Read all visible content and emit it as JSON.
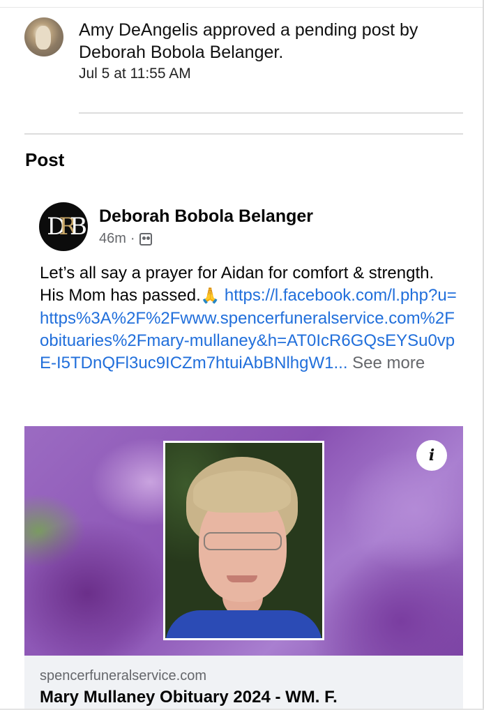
{
  "notification": {
    "message": "Amy DeAngelis approved a pending post by Deborah Bobola Belanger.",
    "timestamp": "Jul 5 at 11:55 AM"
  },
  "section_title": "Post",
  "post": {
    "author": "Deborah Bobola Belanger",
    "avatar_monogram": "DRB",
    "age": "46m",
    "meta_separator": "·",
    "audience_icon": "group-icon",
    "text": "Let’s all say a prayer for Aidan for comfort & strength. His Mom has passed.",
    "emoji": "🙏",
    "link_text": "https://l.facebook.com/l.php?u=https%3A%2F%2Fwww.spencerfuneralservice.com%2Fobituaries%2Fmary-mullaney&h=AT0IcR6GQsEYSu0vpE-I5TDnQFl3uc9ICZm7htuiAbBNlhgW1...",
    "see_more": "See more"
  },
  "link_preview": {
    "domain": "spencerfuneralservice.com",
    "title": "Mary Mullaney Obituary 2024 - WM. F.",
    "info_button": "i"
  }
}
